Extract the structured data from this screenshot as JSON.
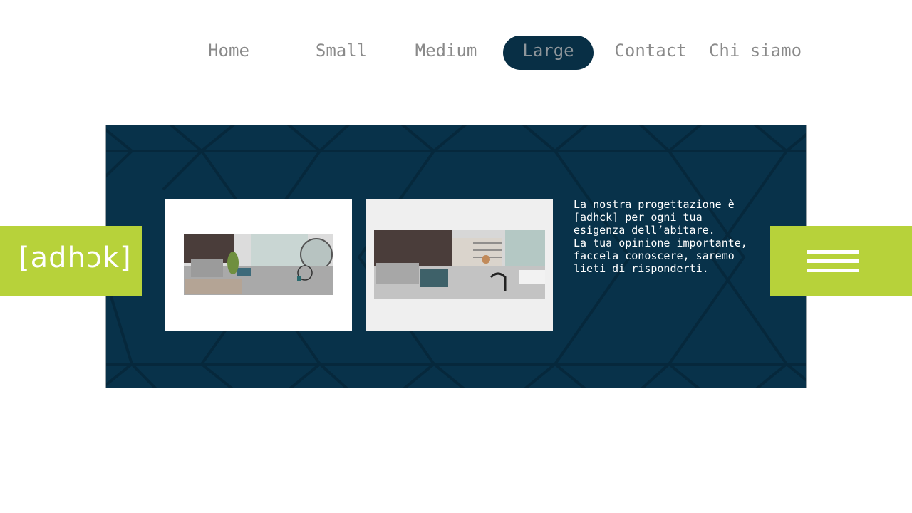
{
  "nav": {
    "items": [
      {
        "label": "Home"
      },
      {
        "label": "Small"
      },
      {
        "label": "Medium"
      },
      {
        "label": "Large",
        "active": true
      },
      {
        "label": "Contact"
      },
      {
        "label": "Chi siamo"
      }
    ]
  },
  "brand": {
    "logo_text": "[adhɔk]"
  },
  "banner": {
    "text_lines": [
      "La nostra progettazione è [adhck] per ogni tua esigenza dell’abitare.",
      "La tua opinione importante, faccela conoscere, saremo lieti di risponderti."
    ]
  },
  "colors": {
    "navy": "#082f45",
    "lime": "#b7d23a",
    "nav_text": "#8a8a8a",
    "white": "#ffffff"
  },
  "icons": {
    "menu": "hamburger-icon"
  }
}
